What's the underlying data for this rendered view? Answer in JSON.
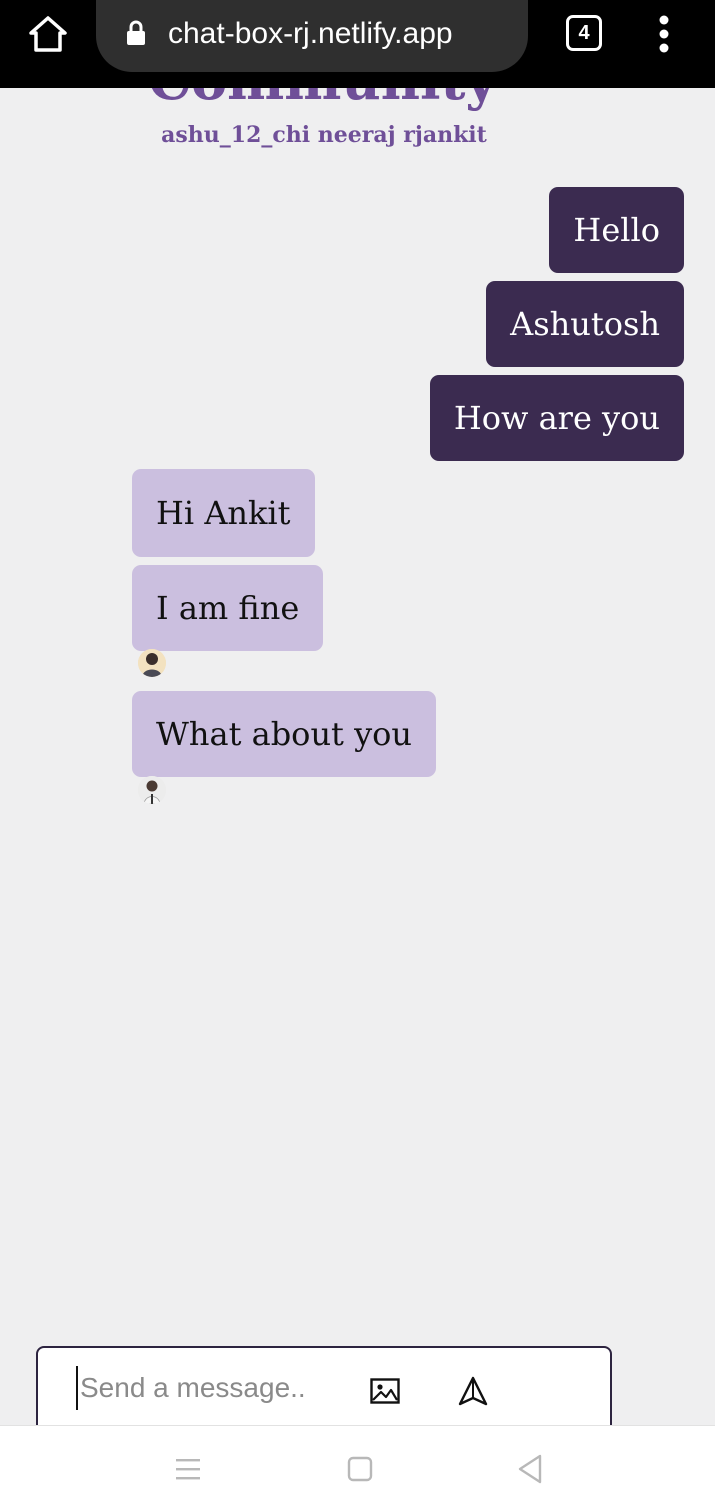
{
  "browser": {
    "url": "chat-box-rj.netlify.app",
    "tab_count": "4"
  },
  "header": {
    "title": "Community",
    "members": "ashu_12_chi neeraj rjankit"
  },
  "messages": [
    {
      "text": "Hello",
      "direction": "sent"
    },
    {
      "text": "Ashutosh",
      "direction": "sent"
    },
    {
      "text": "How are you",
      "direction": "sent"
    },
    {
      "text": "Hi Ankit",
      "direction": "received"
    },
    {
      "text": "I am fine",
      "direction": "received"
    },
    {
      "text": "What about you",
      "direction": "received"
    }
  ],
  "composer": {
    "placeholder": "Send a message..",
    "value": ""
  },
  "colors": {
    "accent": "#6f4f98",
    "sent_bubble": "#3b2b50",
    "received_bubble": "#cbbfdf",
    "background": "#efeff0"
  },
  "icons": {
    "home": "home-icon",
    "lock": "lock-icon",
    "tabs": "tabs-icon",
    "menu": "more-vertical-icon",
    "image": "image-icon",
    "send": "send-icon",
    "nav_menu": "recent-apps-icon",
    "nav_home": "home-square-icon",
    "nav_back": "back-triangle-icon"
  }
}
